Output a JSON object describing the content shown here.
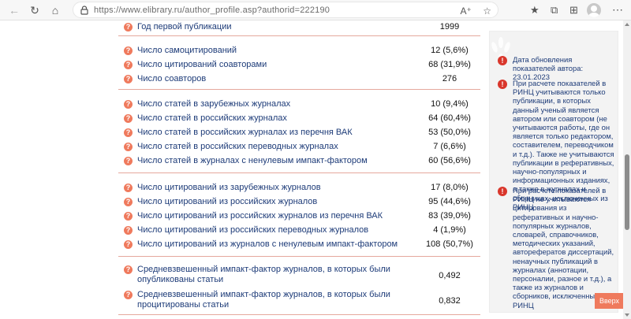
{
  "browser": {
    "url": "https://www.elibrary.ru/author_profile.asp?authorid=222190"
  },
  "stats": {
    "s1": [
      {
        "label": "Год первой публикации",
        "value": "1999"
      }
    ],
    "s2": [
      {
        "label": "Число самоцитирований",
        "value": "12 (5,6%)"
      },
      {
        "label": "Число цитирований соавторами",
        "value": "68 (31,9%)"
      },
      {
        "label": "Число соавторов",
        "value": "276"
      }
    ],
    "s3": [
      {
        "label": "Число статей в зарубежных журналах",
        "value": "10 (9,4%)"
      },
      {
        "label": "Число статей в российских журналах",
        "value": "64 (60,4%)"
      },
      {
        "label": "Число статей в российских журналах из перечня ВАК",
        "value": "53 (50,0%)"
      },
      {
        "label": "Число статей в российских переводных журналах",
        "value": "7 (6,6%)"
      },
      {
        "label": "Число статей в журналах с ненулевым импакт-фактором",
        "value": "60 (56,6%)"
      }
    ],
    "s4": [
      {
        "label": "Число цитирований из зарубежных журналов",
        "value": "17 (8,0%)"
      },
      {
        "label": "Число цитирований из российских журналов",
        "value": "95 (44,6%)"
      },
      {
        "label": "Число цитирований из российских журналов из перечня ВАК",
        "value": "83 (39,0%)"
      },
      {
        "label": "Число цитирований из российских переводных журналов",
        "value": "4 (1,9%)"
      },
      {
        "label": "Число цитирований из журналов с ненулевым импакт-фактором",
        "value": "108 (50,7%)"
      }
    ],
    "s5": [
      {
        "label": "Средневзвешенный импакт-фактор журналов, в которых были опубликованы статьи",
        "value": "0,492"
      },
      {
        "label": "Средневзвешенный импакт-фактор журналов, в которых были процитированы статьи",
        "value": "0,832"
      }
    ]
  },
  "side": {
    "notes": [
      "Дата обновления показателей автора: 23.01.2023",
      "При расчете показателей в РИНЦ учитываются только публикации, в которых данный ученый является автором или соавтором (не учитываются работы, где он является только редактором, составителем, переводчиком и т.д.). Также не учитываются публикации в реферативных, научно-популярных и информационных изданиях, а также в журналах и сборниках, исключенных из РИНЦ",
      "При расчете показателей в РИНЦ не учитываются цитирования из реферативных и научно-популярных журналов, словарей, справочников, методических указаний, авторефератов диссертаций, ненаучных публикаций в журналах (аннотации, персоналии, разное и т.д.), а также из журналов и сборников, исключенных из РИНЦ"
    ],
    "up_label": "Вверх"
  },
  "colors": {
    "accent": "#ef7a5d",
    "link": "#1d3b78",
    "alert": "#d9362b"
  },
  "icons": [
    "back-arrow-icon",
    "refresh-icon",
    "home-icon",
    "lock-icon",
    "read-aloud-icon",
    "favorite-icon",
    "favorites-list-icon",
    "collections-icon",
    "extensions-icon",
    "profile-avatar",
    "more-icon",
    "question-icon",
    "exclamation-icon"
  ]
}
